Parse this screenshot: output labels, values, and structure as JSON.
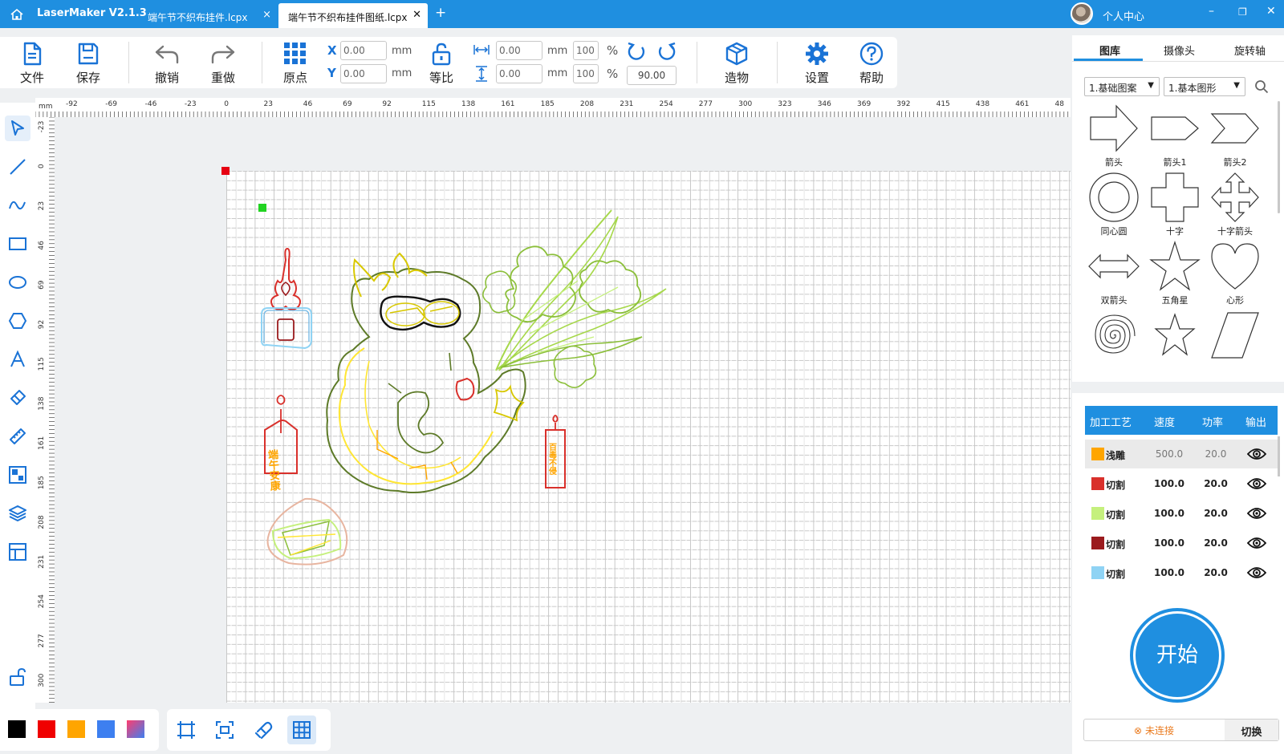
{
  "titlebar": {
    "app_name": "LaserMaker V2.1.3",
    "tabs": [
      {
        "label": "端午节不织布挂件.lcpx",
        "close": "×"
      },
      {
        "label": "端午节不织布挂件图纸.lcpx",
        "close": "✕"
      }
    ],
    "add_tab": "+",
    "user_center": "个人中心",
    "minimize": "–",
    "maximize": "❐",
    "close": "✕"
  },
  "toolbar": {
    "file": "文件",
    "save": "保存",
    "undo": "撤销",
    "redo": "重做",
    "origin": "原点",
    "x_label": "X",
    "y_label": "Y",
    "x_value": "0.00",
    "y_value": "0.00",
    "unit": "mm",
    "lock_ratio": "等比",
    "width_value": "0.00",
    "height_value": "0.00",
    "width_pct": "100",
    "height_pct": "100",
    "pct": "%",
    "rotate_value": "90.00",
    "build": "造物",
    "settings": "设置",
    "help": "帮助"
  },
  "ruler": {
    "unit": "mm",
    "h_ticks": [
      "-92",
      "-69",
      "-46",
      "-23",
      "0",
      "23",
      "46",
      "69",
      "92",
      "115",
      "138",
      "161",
      "185",
      "208",
      "231",
      "254",
      "277",
      "300",
      "323",
      "346",
      "369",
      "392",
      "415",
      "438",
      "461",
      "48"
    ],
    "v_ticks": [
      "-23",
      "0",
      "23",
      "46",
      "69",
      "92",
      "115",
      "138",
      "161",
      "185",
      "208",
      "231",
      "254",
      "277",
      "300"
    ]
  },
  "colors": {
    "accent": "#1f8fe0",
    "palette": [
      "#000000",
      "#f00000",
      "#ffa500",
      "#3d7ff0",
      "gradient"
    ]
  },
  "library": {
    "tabs": [
      "图库",
      "摄像头",
      "旋转轴"
    ],
    "category": "1.基础图案",
    "subcategory": "1.基本图形",
    "shapes": [
      "箭头",
      "箭头1",
      "箭头2",
      "同心圆",
      "十字",
      "十字箭头",
      "双箭头",
      "五角星",
      "心形",
      "",
      "",
      ""
    ]
  },
  "process": {
    "headers": [
      "加工工艺",
      "速度",
      "功率",
      "输出"
    ],
    "rows": [
      {
        "color": "#ffa500",
        "name": "浅雕",
        "speed": "500.0",
        "power": "20.0"
      },
      {
        "color": "#d9302b",
        "name": "切割",
        "speed": "100.0",
        "power": "20.0"
      },
      {
        "color": "#c5f07d",
        "name": "切割",
        "speed": "100.0",
        "power": "20.0"
      },
      {
        "color": "#9b1b1e",
        "name": "切割",
        "speed": "100.0",
        "power": "20.0"
      },
      {
        "color": "#8fd3f4",
        "name": "切割",
        "speed": "100.0",
        "power": "20.0"
      }
    ]
  },
  "start_label": "开始",
  "connection": {
    "status": "未连接",
    "switch": "切换"
  },
  "artwork_text": {
    "tag1": "端午安康",
    "tag2": "百毒不侵"
  }
}
